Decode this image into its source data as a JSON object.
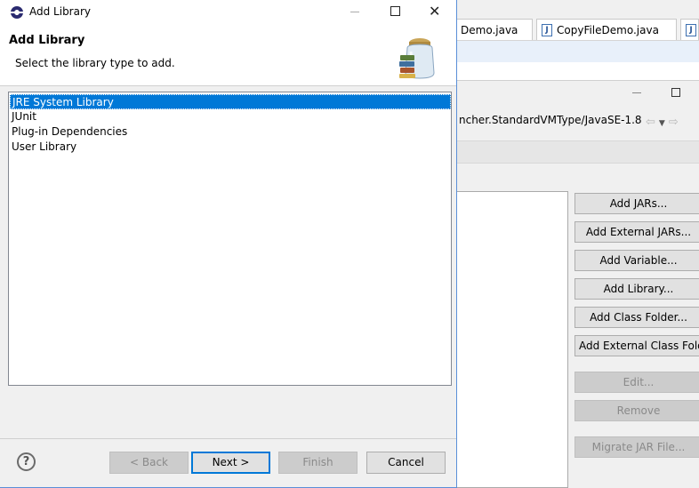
{
  "background": {
    "tabs": [
      "Demo.java",
      "CopyFileDemo.java"
    ],
    "tab_icon_glyph": "J",
    "jre_path": "ncher.StandardVMType/JavaSE-1.8",
    "buttons": {
      "add_jars": "Add JARs...",
      "add_external_jars": "Add External JARs...",
      "add_variable": "Add Variable...",
      "add_library": "Add Library...",
      "add_class_folder": "Add Class Folder...",
      "add_external_class_folder": "Add External Class Folder...",
      "edit": "Edit...",
      "remove": "Remove",
      "migrate_jar": "Migrate JAR File..."
    }
  },
  "dialog": {
    "window_title": "Add Library",
    "header_title": "Add Library",
    "header_description": "Select the library type to add.",
    "library_types": [
      {
        "label": "JRE System Library",
        "selected": true
      },
      {
        "label": "JUnit",
        "selected": false
      },
      {
        "label": "Plug-in Dependencies",
        "selected": false
      },
      {
        "label": "User Library",
        "selected": false
      }
    ],
    "buttons": {
      "back": "< Back",
      "next": "Next >",
      "finish": "Finish",
      "cancel": "Cancel"
    },
    "help_glyph": "?"
  },
  "colors": {
    "selection": "#0078d7",
    "dialog_border": "#5a8fd8",
    "disabled_text": "#8a8a8a"
  },
  "icons": {
    "app": "eclipse-icon",
    "header": "library-jar-icon",
    "help": "help-icon",
    "file": "java-file-icon"
  }
}
